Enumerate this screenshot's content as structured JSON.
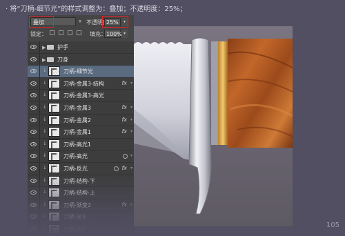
{
  "caption": "· 将“刀柄-细节光”的样式调整为：叠加；不透明度：25%；",
  "page_number": "105",
  "options": {
    "blend_mode": "叠加",
    "opacity_label": "不透明度：",
    "opacity_value": "25%",
    "lock_label": "锁定：",
    "fill_label": "填充：",
    "fill_value": "100%"
  },
  "layers": [
    {
      "name": "护手",
      "kind": "group"
    },
    {
      "name": "刀身",
      "kind": "group"
    },
    {
      "name": "刀柄-细节光",
      "kind": "layer",
      "selected": true,
      "thumb": "checker"
    },
    {
      "name": "刀柄-金属3-结构",
      "kind": "layer",
      "fx": true
    },
    {
      "name": "刀柄-金属3-高光",
      "kind": "layer"
    },
    {
      "name": "刀柄-金属3",
      "kind": "layer",
      "fx": true
    },
    {
      "name": "刀柄-金属2",
      "kind": "layer",
      "fx": true
    },
    {
      "name": "刀柄-金属1",
      "kind": "layer",
      "fx": true
    },
    {
      "name": "刀柄-高光1",
      "kind": "layer"
    },
    {
      "name": "刀柄-高光",
      "kind": "layer",
      "ring": true
    },
    {
      "name": "刀柄-反光",
      "kind": "layer",
      "fx": true,
      "ring": true,
      "thumb": "checker"
    },
    {
      "name": "刀柄-结构-下",
      "kind": "layer",
      "thumb": "checker"
    },
    {
      "name": "刀柄-结构-上",
      "kind": "layer",
      "thumb": "checker"
    },
    {
      "name": "刀柄-渐变2",
      "kind": "layer",
      "fx": true
    },
    {
      "name": "刀柄-光3",
      "kind": "layer"
    },
    {
      "name": "刀柄-光2",
      "kind": "layer"
    }
  ],
  "colors": {
    "background": "#514f61",
    "panel": "#3f3f3f",
    "selected_row": "#5a6b80",
    "highlight_box": "#e0242a",
    "wood": "#b05a22",
    "brass": "#e0a640",
    "steel": "#dcdde5"
  }
}
